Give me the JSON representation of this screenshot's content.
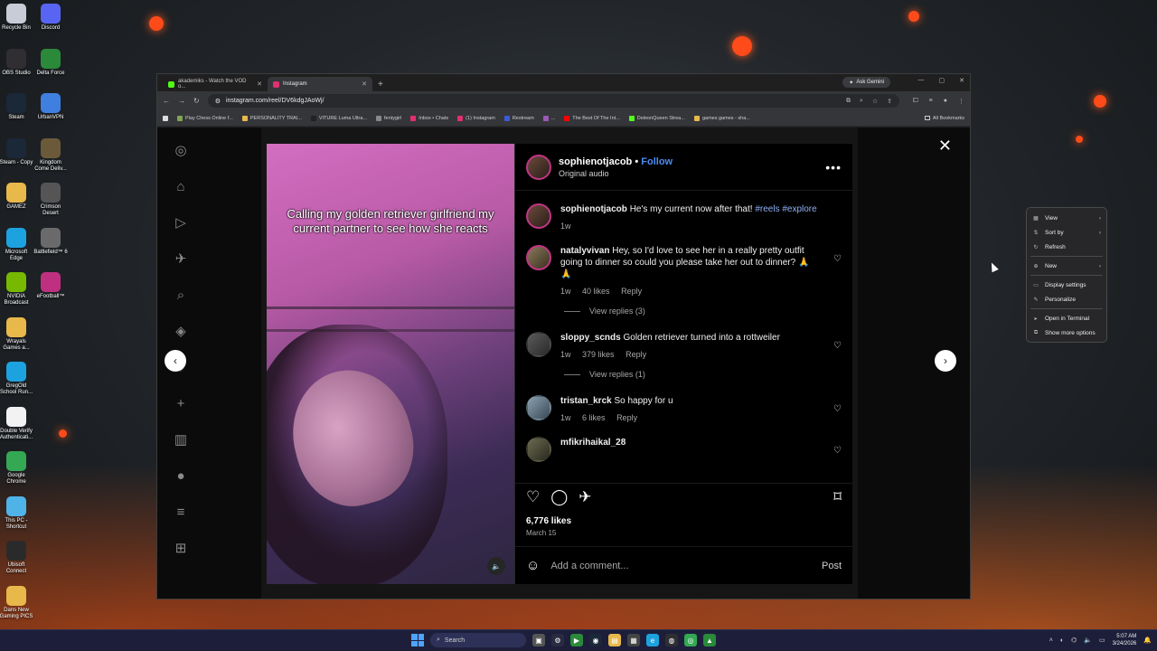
{
  "desktop": {
    "icons": [
      {
        "label": "Recycle Bin",
        "icon": "recycle-bin-icon",
        "color": "#c7ccd6"
      },
      {
        "label": "Discord",
        "icon": "discord-icon",
        "color": "#5865f2"
      },
      {
        "label": "OBS Studio",
        "icon": "obs-icon",
        "color": "#302e31"
      },
      {
        "label": "Delta Force",
        "icon": "delta-force-icon",
        "color": "#2a8a3a"
      },
      {
        "label": "Steam",
        "icon": "steam-icon",
        "color": "#1b2838"
      },
      {
        "label": "UrbanVPN",
        "icon": "urbanvpn-icon",
        "color": "#3f7fe0"
      },
      {
        "label": "Steam - Copy",
        "icon": "steam-icon",
        "color": "#1b2838"
      },
      {
        "label": "Kingdom Come Deliv...",
        "icon": "kingdom-come-icon",
        "color": "#6b5a3a"
      },
      {
        "label": "GAMEZ",
        "icon": "folder-icon",
        "color": "#e8b84a"
      },
      {
        "label": "Crimson Desert",
        "icon": "crimson-desert-icon",
        "color": "#555555"
      },
      {
        "label": "Microsoft Edge",
        "icon": "edge-icon",
        "color": "#1da2e0"
      },
      {
        "label": "Battlefield™ 6",
        "icon": "battlefield-icon",
        "color": "#6a6a6a"
      },
      {
        "label": "NVIDIA Broadcast",
        "icon": "nvidia-icon",
        "color": "#76b900"
      },
      {
        "label": "eFootball™",
        "icon": "efootball-icon",
        "color": "#c03080"
      },
      {
        "label": "Wrayals Games a...",
        "icon": "folder-icon",
        "color": "#e8b84a"
      },
      {
        "label": "GregOld School Run...",
        "icon": "edge-icon",
        "color": "#1da2e0"
      },
      {
        "label": "Double Verify Authenticati...",
        "icon": "document-icon",
        "color": "#f2f2f2"
      },
      {
        "label": "Google Chrome",
        "icon": "chrome-icon",
        "color": "#34a853"
      },
      {
        "label": "This PC - Shortcut",
        "icon": "this-pc-icon",
        "color": "#4fb3e8"
      },
      {
        "label": "Ubisoft Connect",
        "icon": "ubisoft-icon",
        "color": "#2a2a2a"
      },
      {
        "label": "Dans New Gaming PICS",
        "icon": "folder-icon",
        "color": "#e8b84a"
      }
    ]
  },
  "browser": {
    "tabs": [
      {
        "title": "akademiks - Watch the VOD o...",
        "favicon": "kick-icon",
        "color": "#53fc18",
        "active": false
      },
      {
        "title": "Instagram",
        "favicon": "instagram-icon",
        "color": "#e1306c",
        "active": true
      }
    ],
    "new_tab": "+",
    "ask_gemini": "Ask Gemini",
    "url": "instagram.com/reel/DV6kdgJAoWj/",
    "bookmarks": [
      {
        "label": "Play Chess Online f...",
        "color": "#7fa650"
      },
      {
        "label": "PERSONALITY TRAI...",
        "color": "#e8b84a"
      },
      {
        "label": "VITURE Luma Ultra...",
        "color": "#222222"
      },
      {
        "label": "fentygirl",
        "color": "#888888"
      },
      {
        "label": "Inbox • Chats",
        "color": "#e1306c"
      },
      {
        "label": "(1) Instagram",
        "color": "#e1306c"
      },
      {
        "label": "Restream",
        "color": "#3a5bd9"
      },
      {
        "label": "...",
        "color": "#9b59b6"
      },
      {
        "label": "The Best Of The Int...",
        "color": "#ff0000"
      },
      {
        "label": "DeleonQueen Strea...",
        "color": "#53fc18"
      },
      {
        "label": "games games - sha...",
        "color": "#e8b84a"
      }
    ],
    "all_bookmarks": "All Bookmarks"
  },
  "instagram": {
    "video_caption": "Calling my golden retriever girlfriend my current partner to see how she reacts",
    "author": "sophienotjacob",
    "follow": "Follow",
    "audio": "Original audio",
    "caption": {
      "user": "sophienotjacob",
      "text": "He's my current now after that!",
      "tags": "#reels #explore",
      "time": "1w"
    },
    "comments": [
      {
        "user": "natalyvivan",
        "text": "Hey, so I'd love to see her in a really pretty outfit going to dinner so could you please take her out to dinner? 🙏🙏",
        "time": "1w",
        "likes": "40 likes",
        "reply": "Reply",
        "view_replies": "View replies (3)"
      },
      {
        "user": "sloppy_scnds",
        "text": "Golden retriever turned into a rottweiler",
        "time": "1w",
        "likes": "379 likes",
        "reply": "Reply",
        "view_replies": "View replies (1)"
      },
      {
        "user": "tristan_krck",
        "text": "So happy for u",
        "time": "1w",
        "likes": "6 likes",
        "reply": "Reply",
        "view_replies": ""
      },
      {
        "user": "mfikrihaikal_28",
        "text": "",
        "time": "",
        "likes": "",
        "reply": "",
        "view_replies": ""
      }
    ],
    "like_count": "6,776 likes",
    "date": "March 15",
    "add_comment_placeholder": "Add a comment...",
    "post_button": "Post"
  },
  "context_menu": {
    "items": [
      {
        "label": "View",
        "icon": "grid-icon",
        "submenu": true
      },
      {
        "label": "Sort by",
        "icon": "sort-icon",
        "submenu": true
      },
      {
        "label": "Refresh",
        "icon": "refresh-icon",
        "submenu": false
      },
      {
        "label": "New",
        "icon": "plus-icon",
        "submenu": true
      },
      {
        "label": "Display settings",
        "icon": "display-icon",
        "submenu": false
      },
      {
        "label": "Personalize",
        "icon": "brush-icon",
        "submenu": false
      },
      {
        "label": "Open in Terminal",
        "icon": "terminal-icon",
        "submenu": false
      },
      {
        "label": "Show more options",
        "icon": "more-options-icon",
        "submenu": false
      }
    ]
  },
  "taskbar": {
    "search_label": "Search",
    "time": "5:07 AM",
    "date": "3/24/2026"
  }
}
